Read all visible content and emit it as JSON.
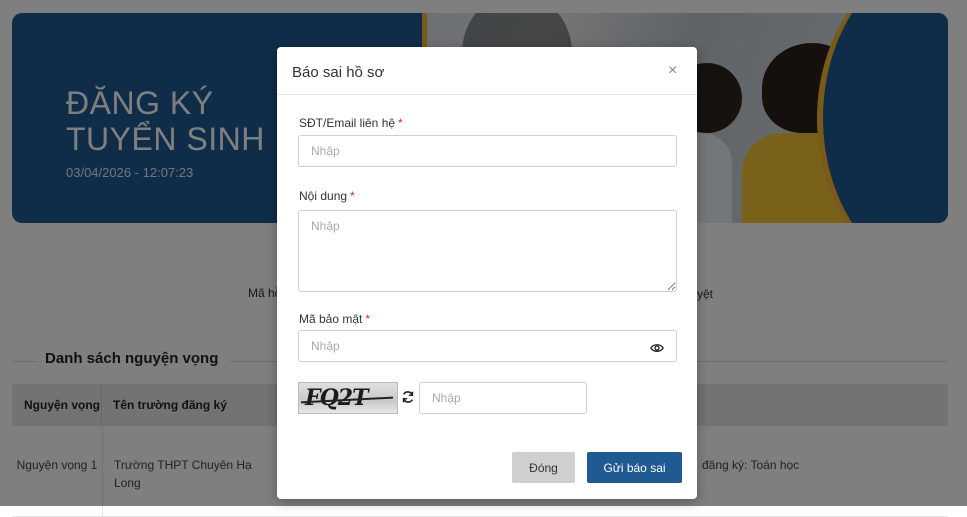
{
  "banner": {
    "title_line1": "ĐĂNG KÝ",
    "title_line2": "TUYỂN SINH",
    "datetime": "03/04/2026 - 12:07:23"
  },
  "page": {
    "info_left": "Mã hồ",
    "info_right": "yệt",
    "section_title": "Danh sách nguyện vọng",
    "table": {
      "headers": [
        "Nguyện vọng",
        "Tên trường đăng ký"
      ],
      "rows": [
        {
          "wish": "Nguyện vọng 1",
          "school": "Trường THPT Chuyên Hạ Long",
          "detail": "đăng ký: Toán học"
        }
      ]
    }
  },
  "modal": {
    "title": "Báo sai hồ sơ",
    "close_symbol": "×",
    "contact_label": "SĐT/Email liên hệ",
    "contact_placeholder": "Nhập",
    "content_label": "Nội dung",
    "content_placeholder": "Nhập",
    "security_label": "Mã bảo mật",
    "security_placeholder": "Nhập",
    "captcha_text": "FQ2T",
    "captcha_placeholder": "Nhập",
    "required_mark": "*",
    "close_button": "Đóng",
    "submit_button": "Gửi báo sai"
  },
  "colors": {
    "primary": "#1f5a92",
    "accent": "#f2b431",
    "required": "#e02424"
  },
  "icons": {
    "close": "close-icon",
    "eye": "eye-icon",
    "refresh": "refresh-icon"
  }
}
